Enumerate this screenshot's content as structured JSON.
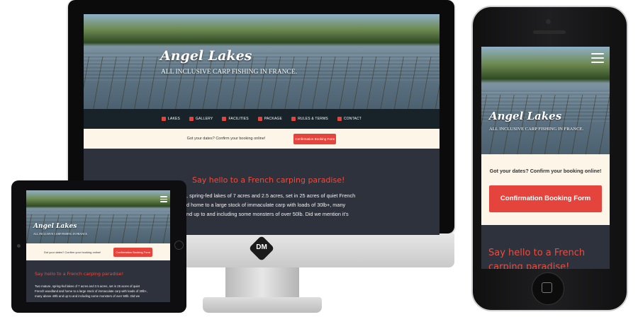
{
  "site": {
    "brand": "Angel Lakes",
    "tagline": "ALL INCLUSIVE CARP FISHING IN FRANCE.",
    "nav": [
      {
        "label": "LAKES",
        "icon": "drop-icon"
      },
      {
        "label": "GALLERY",
        "icon": "image-icon"
      },
      {
        "label": "FACILITIES",
        "icon": "cutlery-icon"
      },
      {
        "label": "PACKAGE",
        "icon": "fish-icon"
      },
      {
        "label": "RULES & TERMS",
        "icon": "gavel-icon"
      },
      {
        "label": "CONTACT",
        "icon": "paper-plane-icon"
      }
    ],
    "booking_prompt": "Got your dates? Confirm your booking online!",
    "booking_button": "Confirmation Booking Form",
    "heading": "Say hello to a French carping paradise!",
    "desktop_body_lines": [
      "e, spring-fed lakes of 7 acres and 2.5 acres, set in 25 acres of quiet French",
      "nd home to a large stock of immaculate carp with loads of 30lb+, many",
      "and up to and including some monsters of over 50lb. Did we mention it's"
    ],
    "tablet_body_lines": [
      "Two mature, spring-fed lakes of 7 acres and 2.5 acres, set in 25 acres of quiet",
      "French woodland and home to a large stock of immaculate carp with loads of 30lb+,",
      "many above 40lb and up to and including some monsters of over 50lb. Did we"
    ],
    "phone_heading_lines": [
      "Say hello to a French",
      "carping paradise!"
    ],
    "device_logo": "DM",
    "colors": {
      "accent": "#e5443d",
      "heading": "#ef4b3c",
      "dark_bg": "#2e323d",
      "nav_bg": "#172229",
      "strip_bg": "#fdf6e8"
    }
  }
}
